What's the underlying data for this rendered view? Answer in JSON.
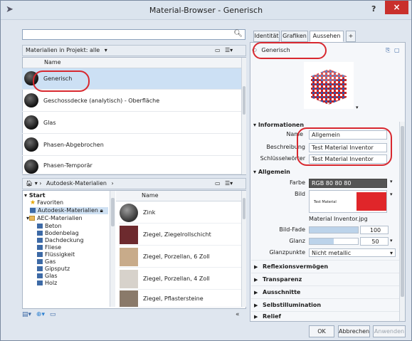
{
  "window": {
    "title": "Material-Browser - Generisch",
    "help": "?",
    "close": "×"
  },
  "search": {
    "value": "",
    "icon": "search-icon"
  },
  "project": {
    "filter_label": "Materialien in Projekt: alle",
    "column": "Name",
    "items": [
      "Generisch",
      "Geschossdecke (analytisch) - Oberfläche",
      "Glas",
      "Phasen-Abgebrochen",
      "Phasen-Temporär"
    ],
    "selected": 0
  },
  "library": {
    "breadcrumb": "Autodesk-Materialien",
    "column": "Name",
    "tree": [
      "Start",
      "Favoriten",
      "Autodesk-Materialien",
      "AEC-Materialien",
      "Beton",
      "Bodenbelag",
      "Dachdeckung",
      "Fliese",
      "Flüssigkeit",
      "Gas",
      "Gipsputz",
      "Glas",
      "Holz"
    ],
    "items": [
      "Zink",
      "Ziegel, Ziegelrollschicht",
      "Ziegel, Porzellan, 6 Zoll",
      "Ziegel, Porzellan, 4 Zoll",
      "Ziegel, Pflastersteine"
    ]
  },
  "tabs": [
    "Identität",
    "Grafiken",
    "Aussehen",
    "+"
  ],
  "asset": {
    "name": "Generisch"
  },
  "info": {
    "title": "Informationen",
    "name_label": "Name",
    "name": "Allgemein",
    "desc_label": "Beschreibung",
    "desc": "Test Material Inventor",
    "kw_label": "Schlüsselwörter",
    "kw": "Test Material Inventor"
  },
  "general": {
    "title": "Allgemein",
    "color_label": "Farbe",
    "color": "RGB 80 80 80",
    "image_label": "Bild",
    "image_thumb_text": "Test Material",
    "image_name": "Material Inventor.jpg",
    "fade_label": "Bild-Fade",
    "fade": "100",
    "fade_fraction": 1.0,
    "gloss_label": "Glanz",
    "gloss": "50",
    "gloss_fraction": 0.5,
    "highlights_label": "Glanzpunkte",
    "highlights": "Nicht metallic"
  },
  "sections": [
    "Reflexionsvermögen",
    "Transparenz",
    "Ausschnitte",
    "Selbstillumination",
    "Relief"
  ],
  "buttons": {
    "ok": "OK",
    "cancel": "Abbrechen",
    "apply": "Anwenden"
  },
  "colors": {
    "accent": "#3d6aa6",
    "highlight_oval": "#d8282f",
    "red_swatch": "#e0262a"
  }
}
